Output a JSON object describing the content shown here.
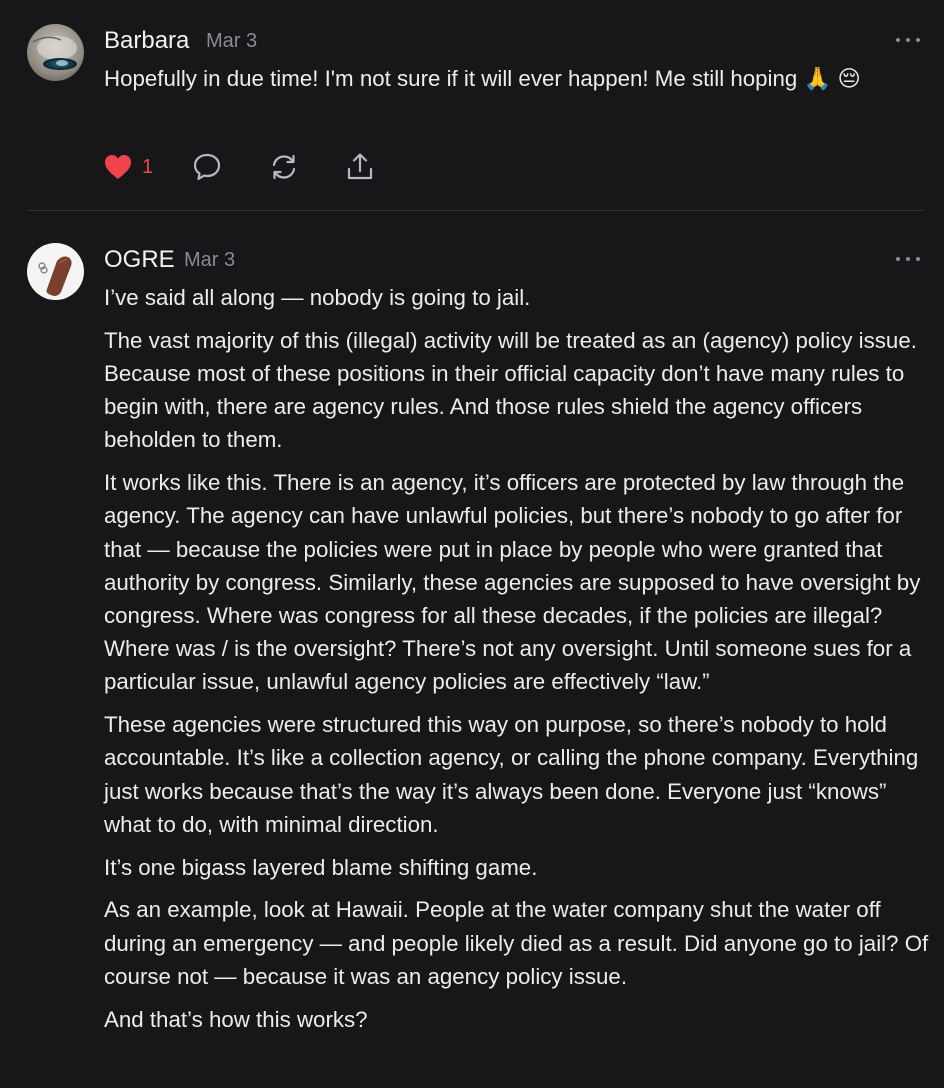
{
  "comments": [
    {
      "author": "Barbara",
      "date": "Mar 3",
      "text": "Hopefully in due time! I'm not sure if it will ever happen! Me still hoping 🙏 😔",
      "like_count": "1",
      "avatar_icon": "marble-sphere-avatar"
    },
    {
      "author": "OGRE",
      "date": "Mar 3",
      "avatar_icon": "leather-keychain-avatar",
      "paragraphs": [
        "I’ve said all along — nobody is going to jail.",
        "The vast majority of this (illegal) activity will be treated as an (agency) policy issue. Because most of these positions in their official capacity don’t have many rules to begin with, there are agency rules. And those rules shield the agency officers beholden to them.",
        "It works like this. There is an agency, it’s officers are protected by law through the agency. The agency can have unlawful policies, but there’s nobody to go after for that — because the policies were put in place by people who were granted that authority by congress. Similarly, these agencies are supposed to have oversight by congress. Where was congress for all these decades, if the policies are illegal? Where was / is the oversight? There’s not any oversight. Until someone sues for a particular issue, unlawful agency policies are effectively “law.”",
        "These agencies were structured this way on purpose, so there’s nobody to hold accountable. It’s like a collection agency, or calling the phone company. Everything just works because that’s the way it’s always been done. Everyone just “knows” what to do, with minimal direction.",
        "It’s one bigass layered blame shifting game.",
        "As an example, look at Hawaii. People at the water company shut the water off during an emergency — and people likely died as a result. Did anyone go to jail? Of course not — because it was an agency policy issue.",
        "And that’s how this works?"
      ]
    }
  ],
  "colors": {
    "background": "#17171a",
    "text": "#ececee",
    "muted": "#8a8a90",
    "like": "#f0444c",
    "divider": "#303034"
  }
}
